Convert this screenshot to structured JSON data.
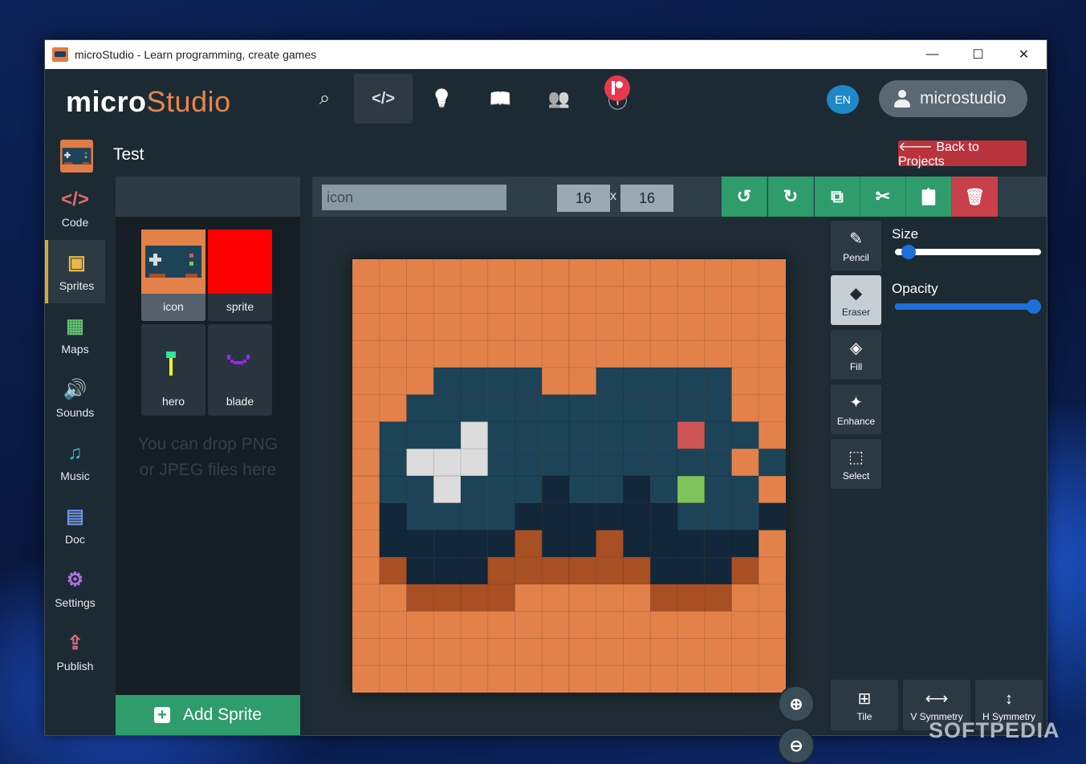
{
  "window": {
    "title": "microStudio - Learn programming, create games",
    "minimize": "—",
    "maximize": "☐",
    "close": "✕"
  },
  "header": {
    "logo_micro": "micro",
    "logo_studio": "Studio",
    "nav": [
      {
        "name": "search-icon",
        "glyph": "⌕"
      },
      {
        "name": "code-icon",
        "glyph": "</>"
      },
      {
        "name": "lightbulb-icon",
        "glyph": "💡"
      },
      {
        "name": "book-icon",
        "glyph": "📖"
      },
      {
        "name": "community-icon",
        "glyph": "👥"
      },
      {
        "name": "info-icon",
        "glyph": "ⓘ"
      }
    ],
    "language": "EN",
    "username": "microstudio"
  },
  "project": {
    "title": "Test",
    "back_label": "🡐 Back to Projects"
  },
  "sidebar": {
    "items": [
      {
        "label": "Code",
        "icon": "</>",
        "color": "#e26a6a"
      },
      {
        "label": "Sprites",
        "icon": "▣",
        "color": "#e7b84a"
      },
      {
        "label": "Maps",
        "icon": "▦",
        "color": "#5fbf6c"
      },
      {
        "label": "Sounds",
        "icon": "🔊",
        "color": "#3cbf8a"
      },
      {
        "label": "Music",
        "icon": "♫",
        "color": "#3fb7d8"
      },
      {
        "label": "Doc",
        "icon": "▤",
        "color": "#6f8fe0"
      },
      {
        "label": "Settings",
        "icon": "⚙",
        "color": "#b06fe0"
      },
      {
        "label": "Publish",
        "icon": "⇪",
        "color": "#e06f7a"
      }
    ]
  },
  "sprites": {
    "items": [
      {
        "label": "icon"
      },
      {
        "label": "sprite"
      },
      {
        "label": "hero"
      },
      {
        "label": "blade"
      }
    ],
    "drop_hint": "You can drop PNG or JPEG files here",
    "add_label": "Add Sprite"
  },
  "editor": {
    "sprite_name": "icon",
    "width": "16",
    "height": "16",
    "x_sep": "x",
    "toolbar": [
      {
        "name": "undo-button",
        "glyph": "↺"
      },
      {
        "name": "redo-button",
        "glyph": "↻"
      },
      {
        "name": "copy-button",
        "glyph": "⧉"
      },
      {
        "name": "cut-button",
        "glyph": "✂"
      },
      {
        "name": "paste-button",
        "glyph": "📋"
      },
      {
        "name": "delete-button",
        "glyph": "🗑"
      }
    ],
    "zoom_in": "⊕",
    "zoom_out": "⊖",
    "palette": {
      "o": "#e2824a",
      "d": "#1d4358",
      "k": "#12283a",
      "b": "#a84f24",
      "w": "#dcdcdc",
      "r": "#cf5555",
      "g": "#7ec45a"
    },
    "pixels": [
      "oooooooooooooooo",
      "oooooooooooooooo",
      "oooooooooooooooo",
      "oooooooooooooooo",
      "oooddddoodddddoo",
      "ooddddddddddddoo",
      "odddwdddddddrddo",
      "odwwwdddddddddod",
      "oddwdddkddkdgddo",
      "okddddkkkkkkdddk",
      "okkkkkbkkbkkkkko",
      "obkkkbbbbbbkkkbo",
      "oobbbbooooobbboo",
      "oooooooooooooooo",
      "oooooooooooooooo",
      "oooooooooooooooo"
    ]
  },
  "tools": {
    "items": [
      {
        "label": "Pencil",
        "icon": "✎"
      },
      {
        "label": "Eraser",
        "icon": "◆"
      },
      {
        "label": "Fill",
        "icon": "◈"
      },
      {
        "label": "Enhance",
        "icon": "✦"
      },
      {
        "label": "Select",
        "icon": "⬚"
      }
    ],
    "size_label": "Size",
    "size_value": 0.05,
    "opacity_label": "Opacity",
    "opacity_value": 1.0,
    "symmetry": [
      {
        "label": "Tile",
        "icon": "⊞"
      },
      {
        "label": "V Symmetry",
        "icon": "⟷"
      },
      {
        "label": "H Symmetry",
        "icon": "↕"
      }
    ]
  },
  "watermark": "SOFTPEDIA"
}
